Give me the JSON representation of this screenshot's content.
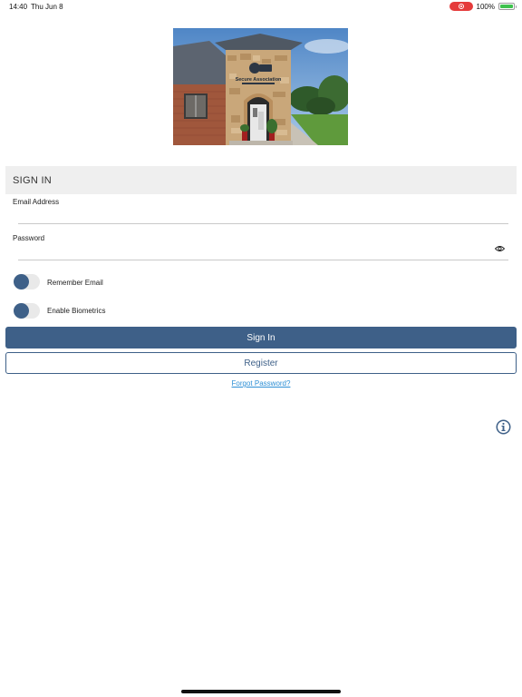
{
  "status_bar": {
    "time": "14:40",
    "date": "Thu Jun 8",
    "battery_percent": "100%",
    "battery_level": 1.0,
    "record_icon": "screen-record-icon",
    "battery_icon": "battery-charging-icon"
  },
  "hero": {
    "image_subject": "storefront-photo",
    "sign_text": "Secure Association",
    "sign_subtext": "MANAGEMENT"
  },
  "signin": {
    "title": "SIGN IN",
    "email_label": "Email Address",
    "email_value": "",
    "password_label": "Password",
    "password_value": "",
    "password_toggle_icon": "eye-icon",
    "remember_email_label": "Remember Email",
    "remember_email_on": false,
    "biometrics_label": "Enable Biometrics",
    "biometrics_on": false,
    "sign_in_button": "Sign In",
    "register_button": "Register",
    "forgot_password": "Forgot Password?"
  },
  "info_icon": "info-icon",
  "colors": {
    "accent": "#3e6088",
    "link": "#2d8fd5",
    "header_bg": "#efefef",
    "record_red": "#e53b3b",
    "battery_green": "#3fc24e"
  }
}
